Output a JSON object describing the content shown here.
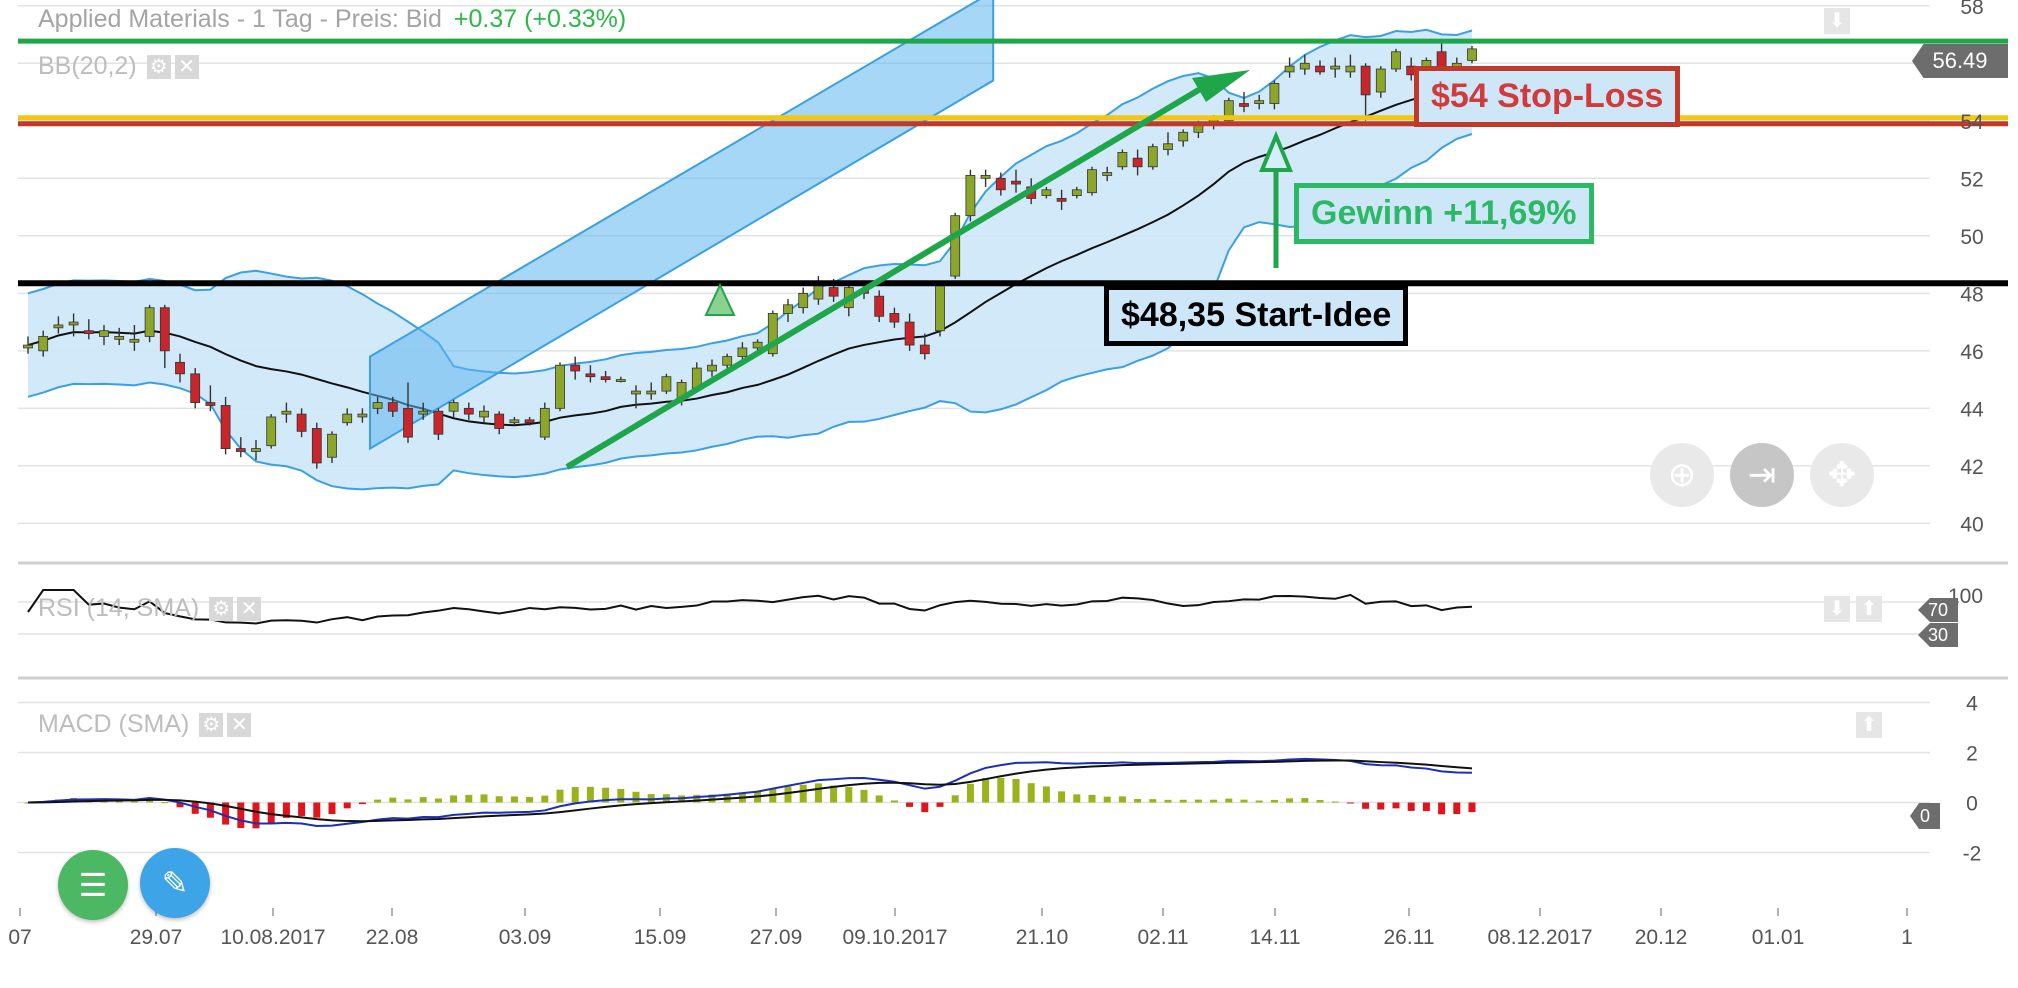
{
  "header": {
    "title": "Applied Materials - 1 Tag - Preis: Bid",
    "change": "+0.37 (+0.33%)",
    "current_price": "56.49"
  },
  "indicators": {
    "bb_label": "BB(20,2)",
    "rsi_label": "RSI (14, SMA)",
    "macd_label": "MACD (SMA)",
    "rsi_axis_top": "100",
    "rsi_level_70": "70",
    "rsi_level_30": "30",
    "macd_zero": "0"
  },
  "annotations": {
    "stop_loss": "$54 Stop-Loss",
    "gain": "Gewinn +11,69%",
    "start": "$48,35 Start-Idee"
  },
  "colors": {
    "green": "#2db84a",
    "stop_red": "#c0392b",
    "yellow": "#f2c80f",
    "band_fill": "#cde7f9",
    "band_line": "#3aa0e4",
    "channel_fill": "#5fb6ee",
    "candle_up": "#8ca62a",
    "candle_down": "#c8262b",
    "macd_pos": "#9bb21a",
    "macd_neg": "#e0151b",
    "macd_line": "#1c2fb8"
  },
  "icons": {
    "zoom": "zoom-icon",
    "jump_end": "jump-to-end-icon",
    "pan": "pan-move-icon",
    "list": "list-icon",
    "pencil": "pencil-icon"
  },
  "chart_data": {
    "type": "candlestick",
    "title": "Applied Materials - 1 Tag - Preis: Bid",
    "price_axis": {
      "ticks": [
        "58",
        "56",
        "54",
        "52",
        "50",
        "48",
        "46",
        "44",
        "42",
        "40"
      ],
      "ylim": [
        38.9,
        58.2
      ]
    },
    "x_ticks": [
      "07",
      "29.07",
      "10.08.2017",
      "22.08",
      "03.09",
      "15.09",
      "27.09",
      "09.10.2017",
      "21.10",
      "02.11",
      "14.11",
      "26.11",
      "08.12.2017",
      "20.12",
      "01.01",
      "1"
    ],
    "horizontal_levels": [
      {
        "label": "$54 Stop-Loss",
        "value": 54
      },
      {
        "label": "$48,35 Start-Idee",
        "value": 48.35
      },
      {
        "label": "56.49",
        "value": 56.49
      }
    ],
    "candles": [
      {
        "o": 46.1,
        "h": 46.5,
        "l": 45.9,
        "c": 46.2
      },
      {
        "o": 46.0,
        "h": 46.7,
        "l": 45.8,
        "c": 46.5
      },
      {
        "o": 46.8,
        "h": 47.2,
        "l": 46.6,
        "c": 46.9
      },
      {
        "o": 46.9,
        "h": 47.3,
        "l": 46.5,
        "c": 47.0
      },
      {
        "o": 46.7,
        "h": 47.1,
        "l": 46.4,
        "c": 46.6
      },
      {
        "o": 46.5,
        "h": 46.9,
        "l": 46.2,
        "c": 46.7
      },
      {
        "o": 46.4,
        "h": 46.8,
        "l": 46.2,
        "c": 46.5
      },
      {
        "o": 46.3,
        "h": 46.9,
        "l": 46.0,
        "c": 46.4
      },
      {
        "o": 46.5,
        "h": 47.6,
        "l": 46.3,
        "c": 47.5
      },
      {
        "o": 47.5,
        "h": 47.6,
        "l": 45.4,
        "c": 46.0
      },
      {
        "o": 45.6,
        "h": 45.9,
        "l": 44.9,
        "c": 45.2
      },
      {
        "o": 45.2,
        "h": 45.4,
        "l": 44.0,
        "c": 44.2
      },
      {
        "o": 44.2,
        "h": 44.8,
        "l": 43.9,
        "c": 44.1
      },
      {
        "o": 44.1,
        "h": 44.4,
        "l": 42.4,
        "c": 42.6
      },
      {
        "o": 42.6,
        "h": 43.0,
        "l": 42.3,
        "c": 42.5
      },
      {
        "o": 42.5,
        "h": 42.9,
        "l": 42.2,
        "c": 42.6
      },
      {
        "o": 42.7,
        "h": 43.8,
        "l": 42.6,
        "c": 43.7
      },
      {
        "o": 43.8,
        "h": 44.2,
        "l": 43.5,
        "c": 43.9
      },
      {
        "o": 43.8,
        "h": 44.0,
        "l": 43.0,
        "c": 43.2
      },
      {
        "o": 43.3,
        "h": 43.5,
        "l": 41.9,
        "c": 42.1
      },
      {
        "o": 42.3,
        "h": 43.2,
        "l": 42.1,
        "c": 43.1
      },
      {
        "o": 43.5,
        "h": 44.0,
        "l": 43.4,
        "c": 43.8
      },
      {
        "o": 43.7,
        "h": 44.0,
        "l": 43.5,
        "c": 43.8
      },
      {
        "o": 44.0,
        "h": 44.4,
        "l": 43.8,
        "c": 44.2
      },
      {
        "o": 44.2,
        "h": 44.4,
        "l": 43.7,
        "c": 43.9
      },
      {
        "o": 44.0,
        "h": 44.9,
        "l": 42.8,
        "c": 43.0
      },
      {
        "o": 43.8,
        "h": 44.2,
        "l": 43.6,
        "c": 43.9
      },
      {
        "o": 43.9,
        "h": 44.0,
        "l": 42.9,
        "c": 43.1
      },
      {
        "o": 43.9,
        "h": 44.3,
        "l": 43.7,
        "c": 44.2
      },
      {
        "o": 44.0,
        "h": 44.2,
        "l": 43.6,
        "c": 43.8
      },
      {
        "o": 43.7,
        "h": 44.1,
        "l": 43.5,
        "c": 43.9
      },
      {
        "o": 43.8,
        "h": 43.9,
        "l": 43.1,
        "c": 43.3
      },
      {
        "o": 43.5,
        "h": 43.7,
        "l": 43.4,
        "c": 43.6
      },
      {
        "o": 43.6,
        "h": 43.7,
        "l": 43.4,
        "c": 43.5
      },
      {
        "o": 43.0,
        "h": 44.2,
        "l": 42.9,
        "c": 44.0
      },
      {
        "o": 44.0,
        "h": 45.6,
        "l": 43.9,
        "c": 45.5
      },
      {
        "o": 45.5,
        "h": 45.8,
        "l": 45.0,
        "c": 45.3
      },
      {
        "o": 45.2,
        "h": 45.5,
        "l": 44.9,
        "c": 45.1
      },
      {
        "o": 45.1,
        "h": 45.3,
        "l": 44.9,
        "c": 45.0
      },
      {
        "o": 45.0,
        "h": 45.1,
        "l": 44.9,
        "c": 45.0
      },
      {
        "o": 44.5,
        "h": 44.8,
        "l": 44.0,
        "c": 44.6
      },
      {
        "o": 44.5,
        "h": 44.9,
        "l": 44.3,
        "c": 44.6
      },
      {
        "o": 44.6,
        "h": 45.2,
        "l": 44.5,
        "c": 45.1
      },
      {
        "o": 44.3,
        "h": 45.0,
        "l": 44.1,
        "c": 44.9
      },
      {
        "o": 44.7,
        "h": 45.6,
        "l": 44.6,
        "c": 45.4
      },
      {
        "o": 45.3,
        "h": 45.7,
        "l": 45.1,
        "c": 45.5
      },
      {
        "o": 45.5,
        "h": 45.9,
        "l": 45.3,
        "c": 45.8
      },
      {
        "o": 45.8,
        "h": 46.3,
        "l": 45.6,
        "c": 46.1
      },
      {
        "o": 46.1,
        "h": 46.4,
        "l": 45.9,
        "c": 46.3
      },
      {
        "o": 45.9,
        "h": 47.4,
        "l": 45.8,
        "c": 47.3
      },
      {
        "o": 47.3,
        "h": 47.8,
        "l": 47.0,
        "c": 47.6
      },
      {
        "o": 47.5,
        "h": 48.2,
        "l": 47.3,
        "c": 48.0
      },
      {
        "o": 47.8,
        "h": 48.6,
        "l": 47.6,
        "c": 48.4
      },
      {
        "o": 48.2,
        "h": 48.5,
        "l": 47.7,
        "c": 47.9
      },
      {
        "o": 47.5,
        "h": 48.3,
        "l": 47.2,
        "c": 48.2
      },
      {
        "o": 48.1,
        "h": 48.4,
        "l": 47.8,
        "c": 48.0
      },
      {
        "o": 47.9,
        "h": 48.1,
        "l": 47.0,
        "c": 47.2
      },
      {
        "o": 47.3,
        "h": 47.5,
        "l": 46.8,
        "c": 47.0
      },
      {
        "o": 47.0,
        "h": 47.3,
        "l": 46.0,
        "c": 46.2
      },
      {
        "o": 46.2,
        "h": 46.6,
        "l": 45.7,
        "c": 45.9
      },
      {
        "o": 46.7,
        "h": 48.4,
        "l": 46.5,
        "c": 48.3
      },
      {
        "o": 48.6,
        "h": 50.8,
        "l": 48.5,
        "c": 50.7
      },
      {
        "o": 50.7,
        "h": 52.3,
        "l": 50.5,
        "c": 52.1
      },
      {
        "o": 52.0,
        "h": 52.3,
        "l": 51.7,
        "c": 52.1
      },
      {
        "o": 52.0,
        "h": 52.2,
        "l": 51.4,
        "c": 51.6
      },
      {
        "o": 51.9,
        "h": 52.3,
        "l": 51.5,
        "c": 51.8
      },
      {
        "o": 51.7,
        "h": 52.0,
        "l": 51.1,
        "c": 51.3
      },
      {
        "o": 51.4,
        "h": 51.7,
        "l": 51.3,
        "c": 51.6
      },
      {
        "o": 51.3,
        "h": 51.6,
        "l": 50.9,
        "c": 51.2
      },
      {
        "o": 51.4,
        "h": 51.7,
        "l": 51.3,
        "c": 51.6
      },
      {
        "o": 51.5,
        "h": 52.4,
        "l": 51.4,
        "c": 52.3
      },
      {
        "o": 52.1,
        "h": 52.4,
        "l": 51.9,
        "c": 52.2
      },
      {
        "o": 52.4,
        "h": 53.0,
        "l": 52.3,
        "c": 52.9
      },
      {
        "o": 52.7,
        "h": 53.0,
        "l": 52.1,
        "c": 52.4
      },
      {
        "o": 52.4,
        "h": 53.2,
        "l": 52.3,
        "c": 53.1
      },
      {
        "o": 53.0,
        "h": 53.6,
        "l": 52.8,
        "c": 53.2
      },
      {
        "o": 53.3,
        "h": 53.7,
        "l": 53.1,
        "c": 53.6
      },
      {
        "o": 53.6,
        "h": 54.0,
        "l": 53.4,
        "c": 53.9
      },
      {
        "o": 53.9,
        "h": 54.2,
        "l": 53.7,
        "c": 54.1
      },
      {
        "o": 54.0,
        "h": 54.8,
        "l": 53.9,
        "c": 54.7
      },
      {
        "o": 54.6,
        "h": 55.0,
        "l": 54.3,
        "c": 54.5
      },
      {
        "o": 54.6,
        "h": 54.9,
        "l": 54.4,
        "c": 54.7
      },
      {
        "o": 54.6,
        "h": 55.4,
        "l": 54.4,
        "c": 55.3
      },
      {
        "o": 55.7,
        "h": 56.2,
        "l": 55.5,
        "c": 55.9
      },
      {
        "o": 55.8,
        "h": 56.3,
        "l": 55.6,
        "c": 56.0
      },
      {
        "o": 55.9,
        "h": 56.1,
        "l": 55.6,
        "c": 55.7
      },
      {
        "o": 55.8,
        "h": 56.2,
        "l": 55.5,
        "c": 55.9
      },
      {
        "o": 55.7,
        "h": 56.3,
        "l": 55.5,
        "c": 55.9
      },
      {
        "o": 55.9,
        "h": 56.0,
        "l": 54.0,
        "c": 54.9
      },
      {
        "o": 55.0,
        "h": 55.9,
        "l": 54.8,
        "c": 55.8
      },
      {
        "o": 55.8,
        "h": 56.5,
        "l": 55.7,
        "c": 56.4
      },
      {
        "o": 55.9,
        "h": 56.2,
        "l": 55.4,
        "c": 55.6
      },
      {
        "o": 55.5,
        "h": 56.2,
        "l": 55.3,
        "c": 56.1
      },
      {
        "o": 56.4,
        "h": 56.8,
        "l": 54.6,
        "c": 55.3
      },
      {
        "o": 55.4,
        "h": 56.2,
        "l": 55.3,
        "c": 56.0
      },
      {
        "o": 56.1,
        "h": 56.6,
        "l": 56.0,
        "c": 56.5
      }
    ],
    "rsi": {
      "ylim": [
        0,
        100
      ],
      "levels": [
        70,
        30
      ]
    },
    "macd": {
      "ticks": [
        "4",
        "2",
        "0",
        "-2"
      ],
      "ylim": [
        -3.5,
        4.5
      ]
    }
  }
}
